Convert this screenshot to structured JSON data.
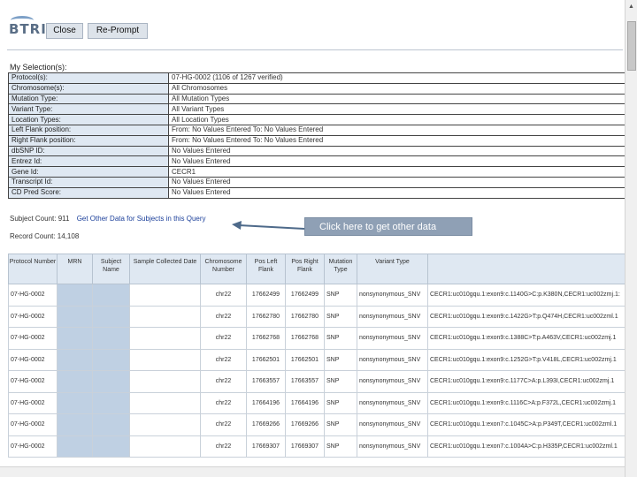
{
  "toolbar": {
    "logo": "BTRIS",
    "close_label": "Close",
    "reprompt_label": "Re-Prompt"
  },
  "selection": {
    "title": "My Selection(s):",
    "rows": [
      {
        "key": "Protocol(s):",
        "value": "07-HG-0002 (1106 of 1267 verified)"
      },
      {
        "key": "Chromosome(s):",
        "value": "All Chromosomes"
      },
      {
        "key": "Mutation Type:",
        "value": "All Mutation Types"
      },
      {
        "key": "Variant Type:",
        "value": "All Variant Types"
      },
      {
        "key": "Location Types:",
        "value": "All Location Types"
      },
      {
        "key": "Left Flank position:",
        "value": "From: No Values Entered To: No Values Entered"
      },
      {
        "key": "Right Flank position:",
        "value": "From: No Values Entered To: No Values Entered"
      },
      {
        "key": "dbSNP ID:",
        "value": "No Values Entered"
      },
      {
        "key": "Entrez Id:",
        "value": "No Values Entered"
      },
      {
        "key": "Gene Id:",
        "value": "CECR1"
      },
      {
        "key": "Transcript Id:",
        "value": "No Values Entered"
      },
      {
        "key": "CD Pred Score:",
        "value": "No Values Entered"
      }
    ]
  },
  "subject_count_label": "Subject Count: 911",
  "get_other_data_link": "Get Other Data for Subjects in this Query",
  "callout": "Click here to get other data",
  "record_count_label": "Record Count: 14,108",
  "results": {
    "headers": [
      "Protocol Number",
      "MRN",
      "Subject Name",
      "Sample Collected Date",
      "Chromosome Number",
      "Pos Left Flank",
      "Pos Right Flank",
      "Mutation Type",
      "Variant Type",
      ""
    ],
    "rows": [
      [
        "07-HG-0002",
        "",
        "",
        "",
        "chr22",
        "17662499",
        "17662499",
        "SNP",
        "nonsynonymous_SNV",
        "CECR1:uc010gqu.1:exon9:c.1140G>C:p.K380N,CECR1:uc002zmj.1:"
      ],
      [
        "07-HG-0002",
        "",
        "",
        "",
        "chr22",
        "17662780",
        "17662780",
        "SNP",
        "nonsynonymous_SNV",
        "CECR1:uc010gqu.1:exon9:c.1422G>T:p.Q474H,CECR1:uc002zml.1"
      ],
      [
        "07-HG-0002",
        "",
        "",
        "",
        "chr22",
        "17662768",
        "17662768",
        "SNP",
        "nonsynonymous_SNV",
        "CECR1:uc010gqu.1:exon9:c.1388C>T:p.A463V,CECR1:uc002zmj.1"
      ],
      [
        "07-HG-0002",
        "",
        "",
        "",
        "chr22",
        "17662501",
        "17662501",
        "SNP",
        "nonsynonymous_SNV",
        "CECR1:uc010gqu.1:exon9:c.1252G>T:p.V418L,CECR1:uc002zmj.1"
      ],
      [
        "07-HG-0002",
        "",
        "",
        "",
        "chr22",
        "17663557",
        "17663557",
        "SNP",
        "nonsynonymous_SNV",
        "CECR1:uc010gqu.1:exon9:c.1177C>A:p.L393I,CECR1:uc002zmj.1"
      ],
      [
        "07-HG-0002",
        "",
        "",
        "",
        "chr22",
        "17664196",
        "17664196",
        "SNP",
        "nonsynonymous_SNV",
        "CECR1:uc010gqu.1:exon9:c.1116C>A:p.F372L,CECR1:uc002zmj.1"
      ],
      [
        "07-HG-0002",
        "",
        "",
        "",
        "chr22",
        "17669266",
        "17669266",
        "SNP",
        "nonsynonymous_SNV",
        "CECR1:uc010gqu.1:exon7:c.1045C>A:p.P349T,CECR1:uc002zml.1"
      ],
      [
        "07-HG-0002",
        "",
        "",
        "",
        "chr22",
        "17669307",
        "17669307",
        "SNP",
        "nonsynonymous_SNV",
        "CECR1:uc010gqu.1:exon7:c.1004A>C:p.H335P,CECR1:uc002zml.1"
      ]
    ]
  },
  "colors": {
    "header_fill": "#dfe8f2",
    "callout_fill": "#8fa0b5",
    "masked_cell": "#bfd0e3",
    "link": "#1b3f9a"
  }
}
